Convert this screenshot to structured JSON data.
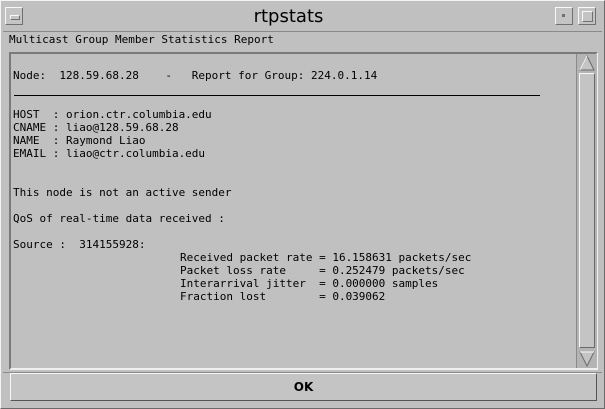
{
  "window": {
    "title": "rtpstats",
    "subtitle": "Multicast Group Member Statistics Report"
  },
  "report": {
    "header": "Node:  128.59.68.28    -   Report for Group: 224.0.1.14",
    "host": "HOST  : orion.ctr.columbia.edu",
    "cname": "CNAME : liao@128.59.68.28",
    "name": "NAME  : Raymond Liao",
    "email": "EMAIL : liao@ctr.columbia.edu",
    "sender_status": "This node is not an active sender",
    "qos_heading": "QoS of real-time data received :",
    "source": "Source :  314155928:",
    "stats": [
      "Received packet rate = 16.158631 packets/sec",
      "Packet loss rate     = 0.252479 packets/sec",
      "Interarrival jitter  = 0.000000 samples",
      "Fraction lost        = 0.039062"
    ]
  },
  "buttons": {
    "ok": "OK"
  },
  "icons": {
    "window_menu": "window-menu-icon",
    "minimize": "minimize-icon",
    "maximize": "maximize-icon",
    "scroll_up": "arrow-up-icon",
    "scroll_down": "arrow-down-icon"
  }
}
